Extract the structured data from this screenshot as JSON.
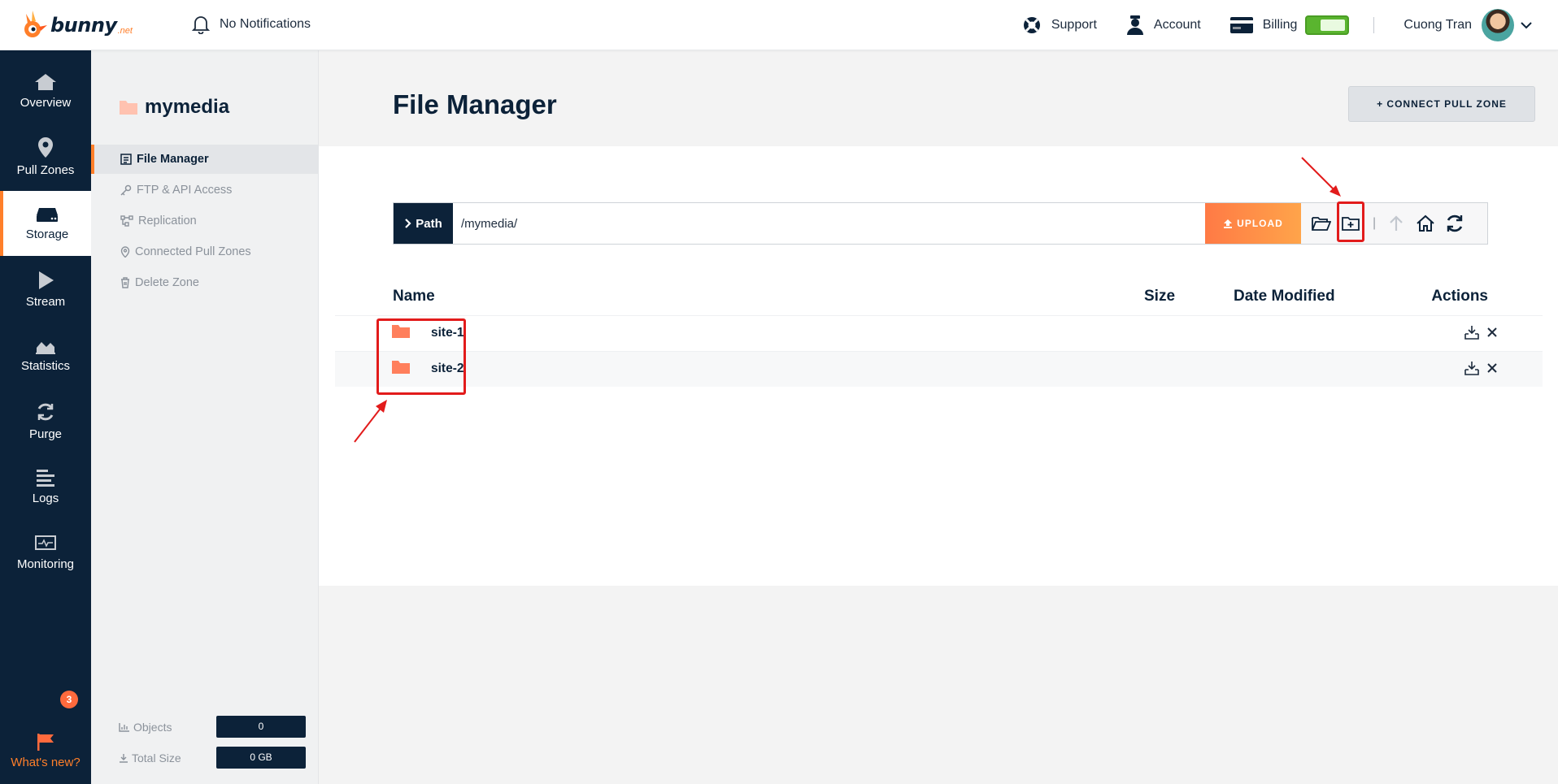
{
  "brand": {
    "name": "bunny",
    "tld": ".net"
  },
  "header": {
    "notifications": "No Notifications",
    "support": "Support",
    "account": "Account",
    "billing": "Billing",
    "user_name": "Cuong Tran"
  },
  "leftnav": {
    "items": [
      "Overview",
      "Pull Zones",
      "Storage",
      "Stream",
      "Statistics",
      "Purge",
      "Logs",
      "Monitoring"
    ],
    "active": "Storage",
    "whats_new": "What's new?",
    "whats_new_badge": "3"
  },
  "zone": {
    "name": "mymedia",
    "menu": [
      "File Manager",
      "FTP & API Access",
      "Replication",
      "Connected Pull Zones",
      "Delete Zone"
    ],
    "active": "File Manager",
    "stats": {
      "objects_label": "Objects",
      "objects_value": "0",
      "size_label": "Total Size",
      "size_value": "0 GB"
    }
  },
  "main": {
    "title": "File Manager",
    "connect_button": "+ CONNECT PULL ZONE",
    "path_label": "Path",
    "path_value": "/mymedia/",
    "upload_button": "UPLOAD",
    "columns": [
      "Name",
      "Size",
      "Date Modified",
      "Actions"
    ],
    "files": [
      {
        "name": "site-1",
        "type": "folder"
      },
      {
        "name": "site-2",
        "type": "folder"
      }
    ]
  },
  "colors": {
    "navy": "#0c2239",
    "accent_orange": "#ff7f2a",
    "annotation_red": "#e21b1b",
    "billing_toggle": "#5ab52f"
  }
}
